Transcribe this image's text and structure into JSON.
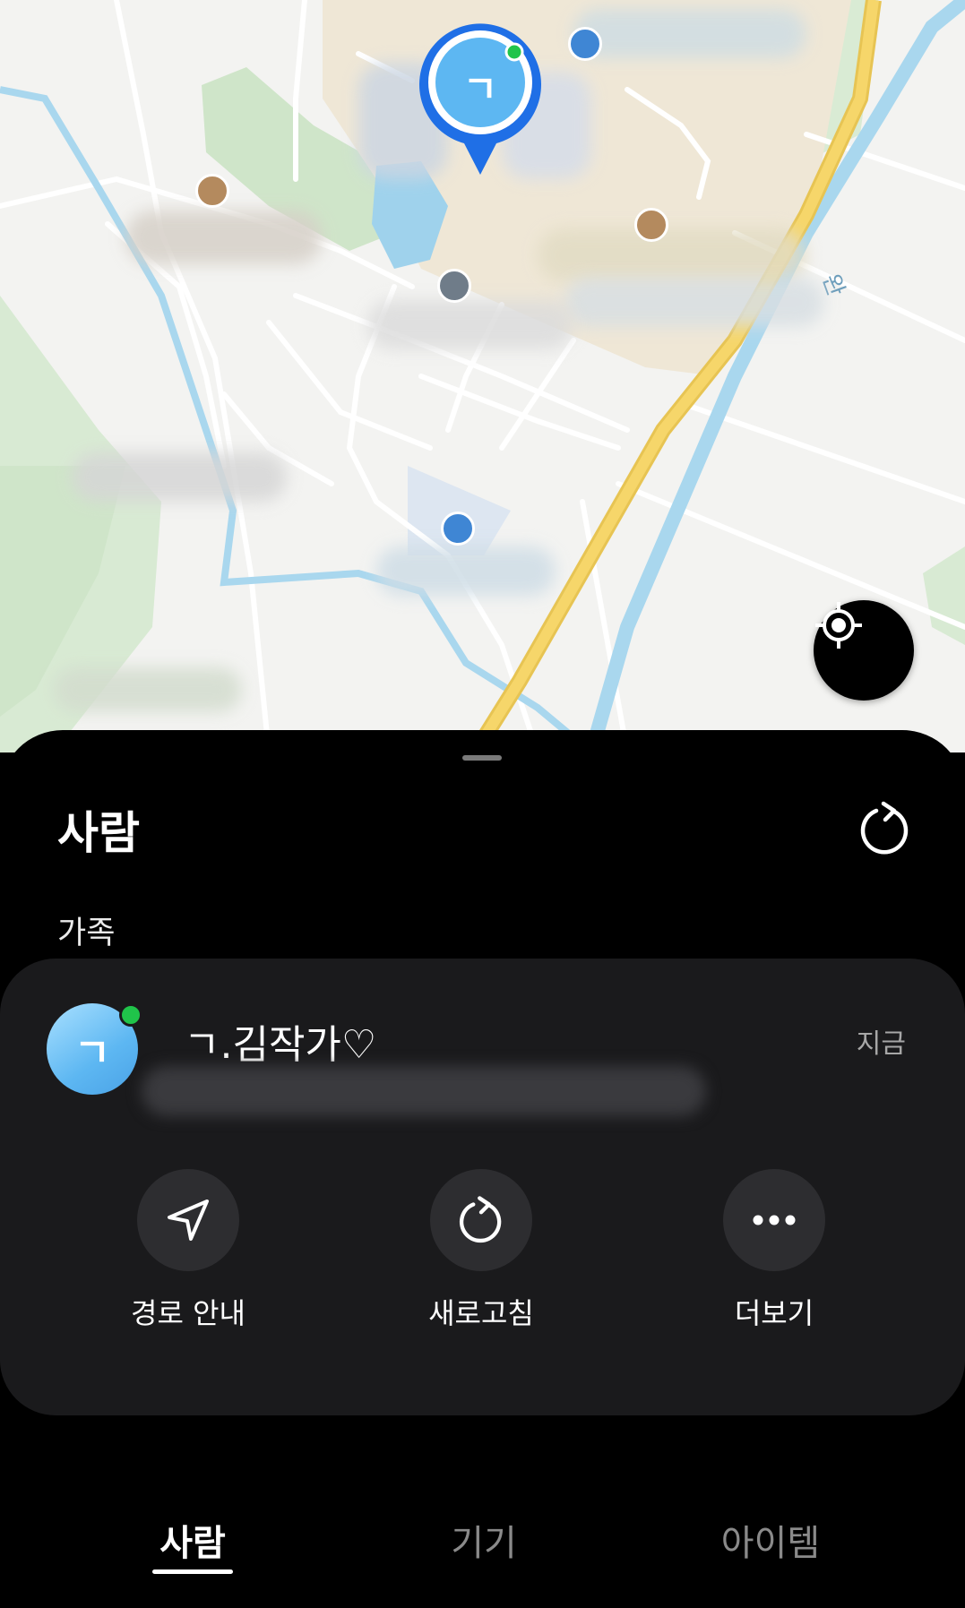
{
  "map": {
    "pin_initial": "ㄱ",
    "locate_button_icon": "crosshair-icon",
    "road_text": "완"
  },
  "sheet": {
    "title": "사람",
    "refresh_icon": "refresh-icon",
    "group_label": "가족"
  },
  "person": {
    "avatar_initial": "ㄱ",
    "name": "ㄱ.김작가♡",
    "time": "지금",
    "online_color": "#20c44a"
  },
  "actions": [
    {
      "label": "경로 안내",
      "icon": "navigation-arrow-icon"
    },
    {
      "label": "새로고침",
      "icon": "refresh-icon"
    },
    {
      "label": "더보기",
      "icon": "more-dots-icon"
    }
  ],
  "tabs": [
    {
      "label": "사람",
      "active": true
    },
    {
      "label": "기기",
      "active": false
    },
    {
      "label": "아이템",
      "active": false
    }
  ],
  "colors": {
    "accent_blue": "#1f6fe6",
    "avatar_blue": "#5db7f2",
    "road_yellow": "#f6d66a",
    "river_blue": "#a9d7ee"
  }
}
